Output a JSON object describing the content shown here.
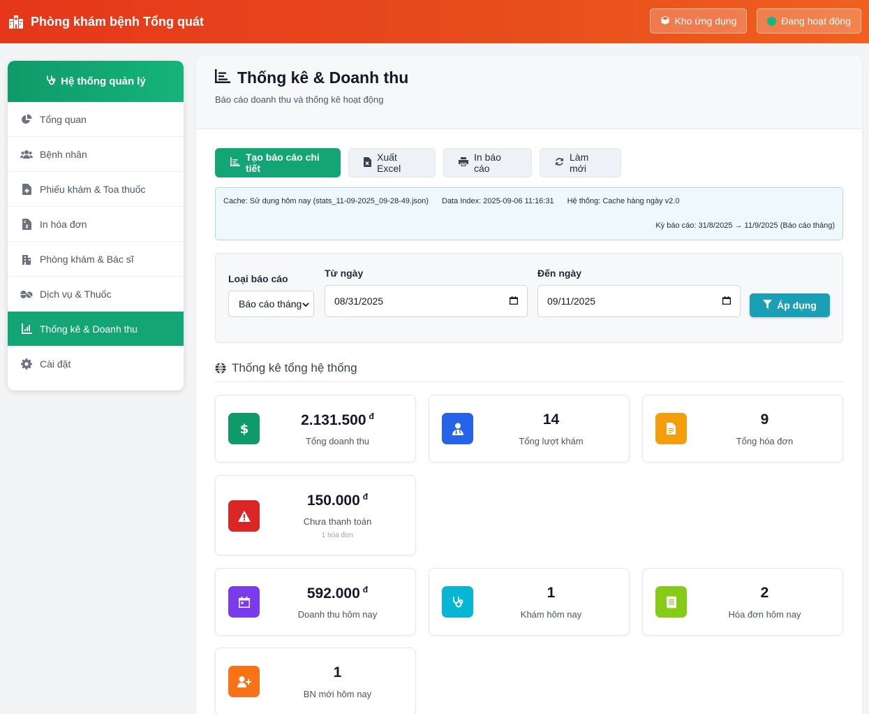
{
  "header": {
    "title": "Phòng khám bệnh Tổng quát",
    "app_store_label": "Kho ứng dụng",
    "status_label": "Đang hoạt động",
    "status_color": "#10b981"
  },
  "sidebar": {
    "title": "Hệ thống quản lý",
    "items": [
      {
        "label": "Tổng quan",
        "icon": "pie-chart-icon"
      },
      {
        "label": "Bệnh nhân",
        "icon": "users-icon"
      },
      {
        "label": "Phiếu khám & Toa thuốc",
        "icon": "medical-file-icon"
      },
      {
        "label": "In hóa đơn",
        "icon": "invoice-icon"
      },
      {
        "label": "Phòng khám & Bác sĩ",
        "icon": "hospital-icon"
      },
      {
        "label": "Dịch vụ & Thuốc",
        "icon": "pills-icon"
      },
      {
        "label": "Thống kê & Doanh thu",
        "icon": "chart-icon",
        "active": true
      },
      {
        "label": "Cài đặt",
        "icon": "gear-icon"
      }
    ]
  },
  "page": {
    "title": "Thống kê & Doanh thu",
    "subtitle": "Báo cáo doanh thu và thống kê hoạt động"
  },
  "actions": {
    "detail_report": "Tạo báo cáo chi tiết",
    "export_excel": "Xuất Excel",
    "print_report": "In báo cáo",
    "refresh": "Làm mới"
  },
  "cache_info": {
    "cache": "Cache: Sử dụng hôm nay (stats_11-09-2025_09-28-49.json)",
    "data_index": "Data Index: 2025-09-06 11:16:31",
    "system": "Hệ thống: Cache hàng ngày v2.0",
    "period": "Kỳ báo cáo: 31/8/2025 → 11/9/2025 (Báo cáo tháng)"
  },
  "filter": {
    "type_label": "Loại báo cáo",
    "type_value": "Báo cáo tháng",
    "from_label": "Từ ngày",
    "from_value": "08/31/2025",
    "to_label": "Đến ngày",
    "to_value": "09/11/2025",
    "apply_label": "Áp dụng"
  },
  "section_title": "Thống kê tổng hệ thống",
  "currency": "đ",
  "cards": [
    {
      "value": "2.131.500",
      "label": "Tổng doanh thu",
      "currency": true,
      "color": "#0f9a6a",
      "icon": "dollar-icon"
    },
    {
      "value": "14",
      "label": "Tổng lượt khám",
      "color": "#2563eb",
      "icon": "doctor-icon"
    },
    {
      "value": "9",
      "label": "Tổng hóa đơn",
      "color": "#f59e0b",
      "icon": "file-invoice-icon"
    },
    {
      "value": "150.000",
      "label": "Chưa thanh toán",
      "note": "1 hóa đơn",
      "currency": true,
      "color": "#dc2626",
      "icon": "warning-icon"
    },
    {
      "value": "592.000",
      "label": "Doanh thu hôm nay",
      "currency": true,
      "color": "#7c3aed",
      "icon": "calendar-icon"
    },
    {
      "value": "1",
      "label": "Khám hôm nay",
      "color": "#06b6d4",
      "icon": "stethoscope-icon"
    },
    {
      "value": "2",
      "label": "Hóa đơn hôm nay",
      "color": "#84cc16",
      "icon": "receipt-icon"
    },
    {
      "value": "1",
      "label": "BN mới hôm nay",
      "color": "#f97316",
      "icon": "user-plus-icon"
    }
  ]
}
